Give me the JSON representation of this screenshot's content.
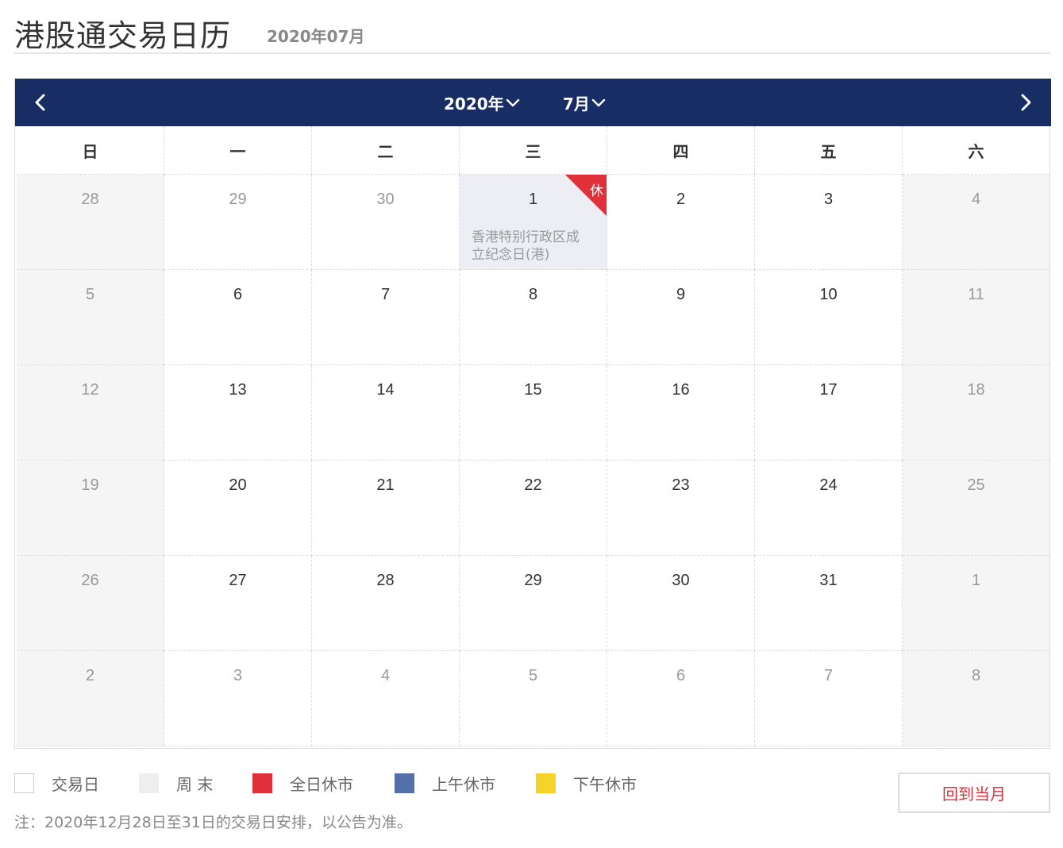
{
  "header": {
    "title": "港股通交易日历",
    "subtitle": "2020年07月"
  },
  "nav": {
    "year": "2020年",
    "month": "7月",
    "prev_icon": "chevron-left-icon",
    "next_icon": "chevron-right-icon"
  },
  "weekdays": [
    "日",
    "一",
    "二",
    "三",
    "四",
    "五",
    "六"
  ],
  "weeks": [
    [
      {
        "num": "28",
        "type": "other-weekend"
      },
      {
        "num": "29",
        "type": "other"
      },
      {
        "num": "30",
        "type": "other"
      },
      {
        "num": "1",
        "type": "holiday",
        "note": "香港特别行政区成立纪念日(港)",
        "tag": "休"
      },
      {
        "num": "2",
        "type": "trading"
      },
      {
        "num": "3",
        "type": "trading"
      },
      {
        "num": "4",
        "type": "weekend"
      }
    ],
    [
      {
        "num": "5",
        "type": "weekend"
      },
      {
        "num": "6",
        "type": "trading"
      },
      {
        "num": "7",
        "type": "trading"
      },
      {
        "num": "8",
        "type": "trading"
      },
      {
        "num": "9",
        "type": "trading"
      },
      {
        "num": "10",
        "type": "trading"
      },
      {
        "num": "11",
        "type": "weekend"
      }
    ],
    [
      {
        "num": "12",
        "type": "weekend"
      },
      {
        "num": "13",
        "type": "trading"
      },
      {
        "num": "14",
        "type": "trading"
      },
      {
        "num": "15",
        "type": "trading"
      },
      {
        "num": "16",
        "type": "trading"
      },
      {
        "num": "17",
        "type": "trading"
      },
      {
        "num": "18",
        "type": "weekend"
      }
    ],
    [
      {
        "num": "19",
        "type": "weekend"
      },
      {
        "num": "20",
        "type": "trading"
      },
      {
        "num": "21",
        "type": "trading"
      },
      {
        "num": "22",
        "type": "trading"
      },
      {
        "num": "23",
        "type": "trading"
      },
      {
        "num": "24",
        "type": "trading"
      },
      {
        "num": "25",
        "type": "weekend"
      }
    ],
    [
      {
        "num": "26",
        "type": "weekend"
      },
      {
        "num": "27",
        "type": "trading"
      },
      {
        "num": "28",
        "type": "trading"
      },
      {
        "num": "29",
        "type": "trading"
      },
      {
        "num": "30",
        "type": "trading"
      },
      {
        "num": "31",
        "type": "trading"
      },
      {
        "num": "1",
        "type": "other-weekend"
      }
    ],
    [
      {
        "num": "2",
        "type": "other-weekend"
      },
      {
        "num": "3",
        "type": "other"
      },
      {
        "num": "4",
        "type": "other"
      },
      {
        "num": "5",
        "type": "other"
      },
      {
        "num": "6",
        "type": "other"
      },
      {
        "num": "7",
        "type": "other"
      },
      {
        "num": "8",
        "type": "other-weekend"
      }
    ]
  ],
  "legend": [
    {
      "label": "交易日",
      "color": "#ffffff"
    },
    {
      "label": "周 末",
      "color": "#eeeeee"
    },
    {
      "label": "全日休市",
      "color": "#e0303a"
    },
    {
      "label": "上午休市",
      "color": "#5470aa"
    },
    {
      "label": "下午休市",
      "color": "#f5d327"
    }
  ],
  "note": "注：2020年12月28日至31日的交易日安排，以公告为准。",
  "back_button": "回到当月",
  "colors": {
    "nav_bg": "#172d63",
    "holiday_red": "#e0303a",
    "weekend_bg": "#f5f5f5",
    "holiday_bg": "#eceef4"
  }
}
